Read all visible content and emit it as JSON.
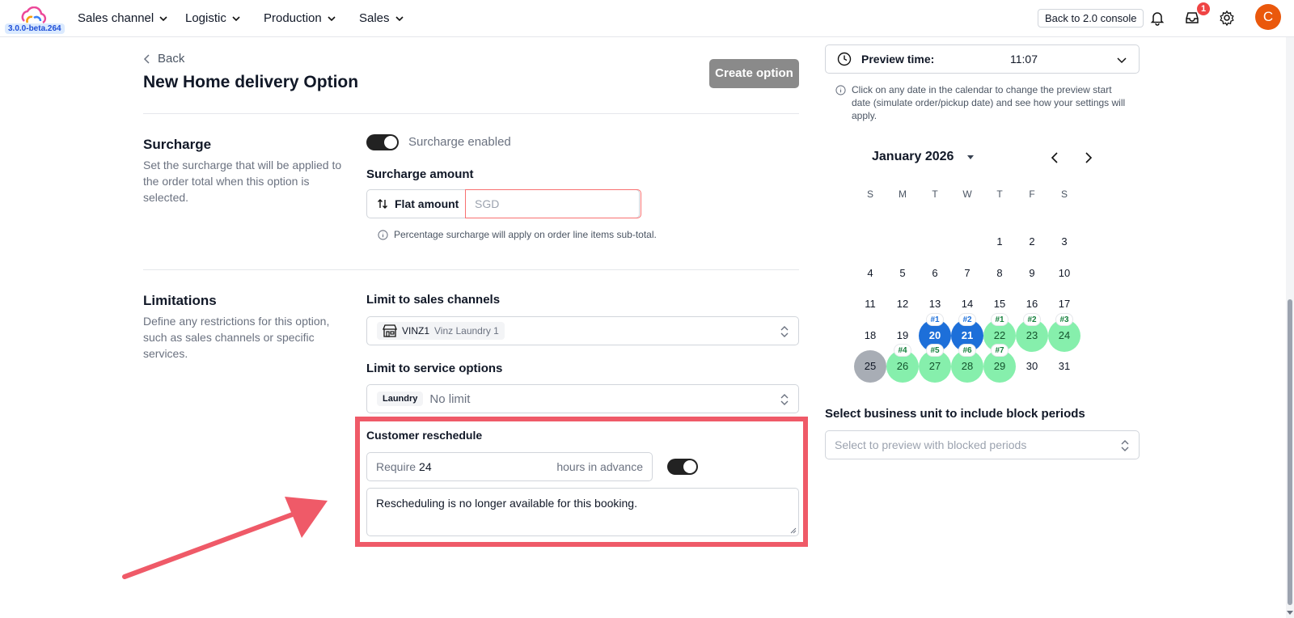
{
  "topbar": {
    "version": "3.0.0-beta.264",
    "nav": [
      "Sales channel",
      "Logistic",
      "Production",
      "Sales"
    ],
    "console_button": "Back to 2.0 console",
    "notification_count": "1",
    "avatar_letter": "C"
  },
  "page": {
    "back_label": "Back",
    "title_prefix": "New ",
    "title_strong": "Home delivery",
    "title_suffix": " Option",
    "create_button": "Create option"
  },
  "surcharge": {
    "title": "Surcharge",
    "description": "Set the surcharge that will be applied to the order total when this option is selected.",
    "toggle_label": "Surcharge enabled",
    "amount_label": "Surcharge amount",
    "amount_type": "Flat amount",
    "amount_placeholder": "SGD",
    "hint": "Percentage surcharge will apply on order line items sub-total."
  },
  "limitations": {
    "title": "Limitations",
    "description": "Define any restrictions for this option, such as sales channels or specific services.",
    "sales_channels_label": "Limit to sales channels",
    "sales_channel_code": "VINZ1",
    "sales_channel_name": "Vinz Laundry 1",
    "service_options_label": "Limit to service options",
    "service_chip": "Laundry",
    "service_value": "No limit",
    "reschedule_label": "Customer reschedule",
    "require_prefix": "Require",
    "require_hours": "24",
    "require_suffix": "hours in advance",
    "reschedule_message": "Rescheduling is no longer available for this booking."
  },
  "preview": {
    "label": "Preview time:",
    "time": "11:07",
    "note": "Click on any date in the calendar to change the preview start date (simulate order/pickup date) and see how your settings will apply.",
    "month": "January 2026",
    "weekdays": [
      "S",
      "M",
      "T",
      "W",
      "T",
      "F",
      "S"
    ],
    "days": [
      "1",
      "2",
      "3",
      "4",
      "5",
      "6",
      "7",
      "8",
      "9",
      "10",
      "11",
      "12",
      "13",
      "14",
      "15",
      "16",
      "17",
      "18",
      "19",
      "20",
      "21",
      "22",
      "23",
      "24",
      "25",
      "26",
      "27",
      "28",
      "29",
      "30",
      "31"
    ],
    "blue_days": [
      "20",
      "21"
    ],
    "green_days": [
      "22",
      "23",
      "24",
      "26",
      "27",
      "28",
      "29"
    ],
    "selected_day": "25",
    "day_tags": {
      "20": "#1",
      "21": "#2",
      "22": "#1",
      "23": "#2",
      "24": "#3",
      "26": "#4",
      "27": "#5",
      "28": "#6",
      "29": "#7"
    },
    "business_unit_label": "Select business unit to include block periods",
    "business_unit_placeholder": "Select to preview with blocked periods"
  },
  "colors": {
    "highlight": "#ef5a68",
    "blue": "#1d6fd9",
    "green": "#86efac",
    "avatar": "#ea580c"
  }
}
